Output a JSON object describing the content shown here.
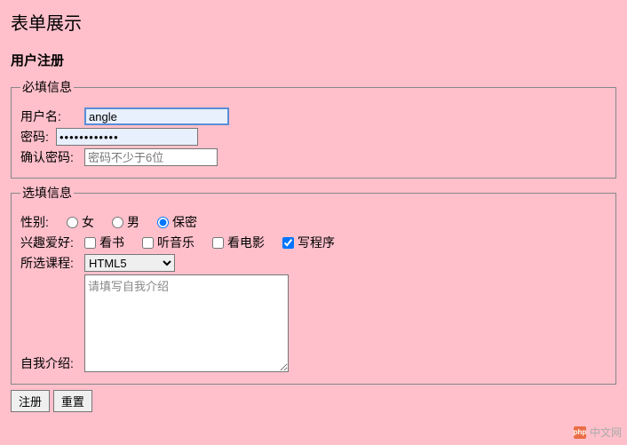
{
  "title": "表单展示",
  "sectionTitle": "用户注册",
  "fieldsets": {
    "required": {
      "legend": "必填信息",
      "username": {
        "label": "用户名:",
        "value": "angle"
      },
      "password": {
        "label": "密码:",
        "value": "••••••••••••"
      },
      "confirm": {
        "label": "确认密码:",
        "placeholder": "密码不少于6位",
        "value": ""
      }
    },
    "optional": {
      "legend": "选填信息",
      "gender": {
        "label": "性别:",
        "options": [
          {
            "label": "女",
            "checked": false
          },
          {
            "label": "男",
            "checked": false
          },
          {
            "label": "保密",
            "checked": true
          }
        ]
      },
      "hobbies": {
        "label": "兴趣爱好:",
        "options": [
          {
            "label": "看书",
            "checked": false
          },
          {
            "label": "听音乐",
            "checked": false
          },
          {
            "label": "看电影",
            "checked": false
          },
          {
            "label": "写程序",
            "checked": true
          }
        ]
      },
      "course": {
        "label": "所选课程:",
        "selected": "HTML5"
      },
      "intro": {
        "label": "自我介绍:",
        "placeholder": "请填写自我介绍",
        "value": ""
      }
    }
  },
  "buttons": {
    "submit": "注册",
    "reset": "重置"
  },
  "watermark": {
    "logo": "php",
    "text": "中文网"
  }
}
